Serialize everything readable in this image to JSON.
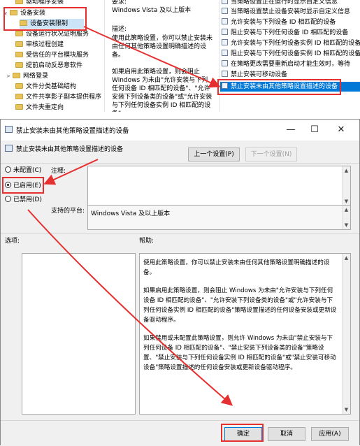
{
  "top": {
    "tree_items": [
      "驱动程序安装",
      "设备安装",
      "设备安装限制",
      "设备运行状况证明服务",
      "审核过程创建",
      "受信任的平台模块服务",
      "提前启动反恶意软件",
      "网络登录",
      "文件分类基础结构",
      "文件共享影子副本提供程序",
      "文件夹重定向"
    ],
    "description": {
      "requirement_label": "要求:",
      "requirement_value": "Windows Vista 及以上版本",
      "desc_label": "描述:",
      "desc_text": "使用此策略设置，你可以禁止安装未由任何其他策略设置明确描述的设备。",
      "desc_text2": "如果启用此策略设置，则会阻止 Windows 为未由\"允许安装与下列任何设备 ID 相匹配的设备\"、\"允许安装下列设备类的设备\"或\"允许安装与下列任何设备实例 ID 相匹配的设备\""
    },
    "policies": [
      "当策略设置正在运行时显示自定义信息",
      "当策略设置禁止设备安装时显示自定义信息",
      "允许安装与下列设备 ID 相匹配的设备",
      "阻止安装与下列任何设备 ID 相匹配的设备",
      "允许安装与下列任何设备实例 ID 相匹配的设备",
      "阻止安装与下列任何设备实例 ID 相匹配的设备",
      "在策略更改需要重新启动才能生效时，等待",
      "禁止安装可移动设备",
      "禁止安装未由其他策略设置描述的设备"
    ]
  },
  "dialog": {
    "window_title": "禁止安装未由其他策略设置描述的设备",
    "window_buttons": [
      "—",
      "☐",
      "✕"
    ],
    "policy_title": "禁止安装未由其他策略设置描述的设备",
    "prev_setting": "上一个设置(P)",
    "next_setting": "下一个设置(N)",
    "radio_not_configured": "未配置(C)",
    "radio_enabled": "已启用(E)",
    "radio_disabled": "已禁用(D)",
    "comment_label": "注释:",
    "platform_label": "支持的平台:",
    "platform_value": "Windows Vista 及以上版本",
    "options_label": "选项:",
    "help_label": "帮助:",
    "help_p1": "使用此策略设置，你可以禁止安装未由任何其他策略设置明确描述的设备。",
    "help_p2": "如果启用此策略设置，则会阻止 Windows 为未由\"允许安装与下列任何设备 ID 相匹配的设备\"、\"允许安装下列设备类的设备\"或\"允许安装与下列任何设备实例 ID 相匹配的设备\"策略设置描述的任何设备安装或更新设备驱动程序。",
    "help_p3": "如果禁用或未配置此策略设置，则允许 Windows 为未由\"禁止安装与下列任何设备 ID 相匹配的设备\"、\"禁止安装下列设备类的设备\"策略设置、\"禁止安装与下列任何设备实例 ID 相匹配的设备\"或\"禁止安装可移动设备\"策略设置描述的任何设备安装或更新设备驱动程序。",
    "ok": "确定",
    "cancel": "取消",
    "apply": "应用(A)"
  },
  "colors": {
    "annotation": "#e63030",
    "selection": "#0078d7"
  }
}
